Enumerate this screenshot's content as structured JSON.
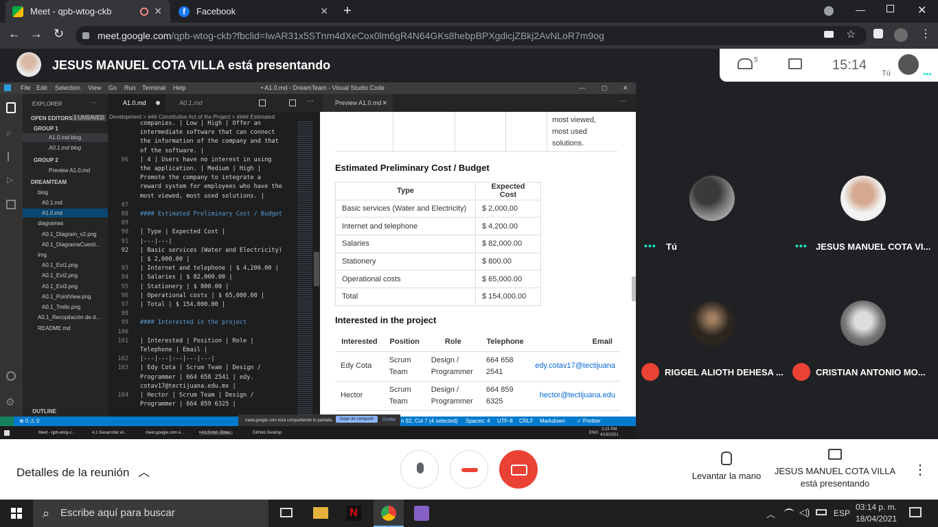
{
  "browser": {
    "tabs": [
      {
        "label": "Meet - qpb-wtog-ckb",
        "active": true
      },
      {
        "label": "Facebook",
        "active": false
      }
    ],
    "url_host": "meet.google.com",
    "url_path": "/qpb-wtog-ckb?fbclid=IwAR31x5STnm4dXeCox0lm6gR4N64GKs8hebpBPXgdicjZBkj2AvNLoR7m9og"
  },
  "meet": {
    "presenter_banner": "JESUS MANUEL COTA VILLA está presentando",
    "people_count": "5",
    "time": "15:14",
    "me_label": "Tú",
    "participants": [
      {
        "name": "Tú",
        "muted": false
      },
      {
        "name": "JESUS MANUEL COTA VI...",
        "muted": false
      },
      {
        "name": "RIGGEL ALIOTH DEHESA ...",
        "muted": true
      },
      {
        "name": "CRISTIAN ANTONIO MO...",
        "muted": true
      }
    ],
    "meeting_details": "Detalles de la reunión",
    "raise_hand": "Levantar la mano",
    "presenting_1": "JESUS MANUEL COTA VILLA",
    "presenting_2": "está presentando"
  },
  "vscode": {
    "menu": [
      "File",
      "Edit",
      "Selection",
      "View",
      "Go",
      "Run",
      "Terminal",
      "Help"
    ],
    "title": "• A1.0.md - DreamTeam - Visual Studio Code",
    "explorer": {
      "header": "EXPLORER",
      "open_editors": "OPEN EDITORS",
      "unsaved": "1 UNSAVED",
      "group1": "GROUP 1",
      "group2": "GROUP 2",
      "g1_files": [
        "A1.0.md blog",
        "A0.1.md blog"
      ],
      "g2_files": [
        "Preview A1.0.md"
      ],
      "workspace": "DREAMTEAM",
      "tree": [
        "blog",
        "A0.1.md",
        "A1.0.md",
        "diagramas",
        "A0.1_Diagram_v2.png",
        "A0.1_DiagramaCuesti...",
        "img",
        "A0.1_Evi1.png",
        "A0.1_Evi2.png",
        "A0.1_Evi3.png",
        "A0.1_PointView.png",
        "A0.1_Trello.png",
        "A0.1_Recopilación de d...",
        "README.md"
      ],
      "outline": "OUTLINE"
    },
    "editor_tabs": [
      "A1.0.md",
      "A0.1.md"
    ],
    "breadcrumb": "Development > ### Constitutive Act of the Project > #### Estimated",
    "code": [
      [
        "",
        "companies. | Low | High | Offer an"
      ],
      [
        "",
        "intermediate software that can connect"
      ],
      [
        "",
        "the information of the company and that"
      ],
      [
        "",
        "of the software. |"
      ],
      [
        "86",
        "| 4 | Users have no interest in using"
      ],
      [
        "",
        "the application. | Medium | High |"
      ],
      [
        "",
        "Promote the company to integrate a"
      ],
      [
        "",
        "reward system for employees who have the"
      ],
      [
        "",
        "most viewed, most used solutions. |"
      ],
      [
        "87",
        ""
      ],
      [
        "88",
        "#### Estimated Preliminary Cost / Budget"
      ],
      [
        "89",
        ""
      ],
      [
        "90",
        "| Type | Expected Cost |"
      ],
      [
        "91",
        "|---|---|"
      ],
      [
        "92",
        "| Basic services (Water and Electricity)"
      ],
      [
        "",
        "| $ 2,000.00 |"
      ],
      [
        "93",
        "| Internet and telephone | $ 4,200.00 |"
      ],
      [
        "94",
        "| Salaries | $ 82,000.00 |"
      ],
      [
        "95",
        "| Stationery | $ 800.00 |"
      ],
      [
        "96",
        "| Operational costs | $ 65,000.00 |"
      ],
      [
        "97",
        "| Total | $ 154,000.00 |"
      ],
      [
        "98",
        ""
      ],
      [
        "99",
        "#### Interested in the project"
      ],
      [
        "100",
        ""
      ],
      [
        "101",
        "| Interested  | Position  | Role  |"
      ],
      [
        "",
        "Telephone  | Email |"
      ],
      [
        "102",
        "|---|---|---|---|---|"
      ],
      [
        "103",
        "| Edy Cota | Scrum Team | Design /"
      ],
      [
        "",
        "Programmer | 664 658 2541 | edy."
      ],
      [
        "",
        "cotav17@tectijuana.edu.mx |"
      ],
      [
        "104",
        "| Hector | Scrum Team | Design /"
      ],
      [
        "",
        "Programmer | 664 859 6325 |"
      ]
    ],
    "preview_tab": "Preview A1.0.md",
    "preview_top": [
      "most viewed,",
      "most used",
      "solutions."
    ],
    "cost_title": "Estimated Preliminary Cost / Budget",
    "cost_headers": [
      "Type",
      "Expected Cost"
    ],
    "cost_rows": [
      [
        "Basic services (Water and Electricity)",
        "$ 2,000.00"
      ],
      [
        "Internet and telephone",
        "$ 4,200.00"
      ],
      [
        "Salaries",
        "$ 82,000.00"
      ],
      [
        "Stationery",
        "$ 800.00"
      ],
      [
        "Operational costs",
        "$ 65,000.00"
      ],
      [
        "Total",
        "$ 154,000.00"
      ]
    ],
    "interest_title": "Interested in the project",
    "interest_headers": [
      "Interested",
      "Position",
      "Role",
      "Telephone",
      "Email"
    ],
    "interest_rows": [
      [
        "Edy Cota",
        "Scrum Team",
        "Design / Programmer",
        "664 658 2541",
        "edy.cotav17@tectijuana"
      ],
      [
        "Hector",
        "Scrum Team",
        "Design / Programmer",
        "664 859 6325",
        "hector@tectijuana.edu"
      ]
    ],
    "status": {
      "left": "⊗ 0 ⚠ 0",
      "sharing": "meet.google.com está compartiendo tu pantalla.",
      "stop_share": "Dejar de compartir",
      "hide": "Ocultar",
      "pos": "n 92, Col 7 (4 selected)",
      "spaces": "Spaces: 4",
      "enc": "UTF-8",
      "eol": "CRLF",
      "lang": "Markdown",
      "prettier": "✓ Prettier"
    },
    "inner_taskbar": [
      "Meet - qpb-wtog-c...",
      "4.1 Desarrollar el...",
      "meet.google.com e...",
      "• A1.0.md - Drea...",
      "GitHub Desktop"
    ],
    "inner_clock": "3:15 PM",
    "inner_date": "4/18/2021",
    "inner_lang": "ENG"
  },
  "windows": {
    "search_placeholder": "Escribe aquí para buscar",
    "lang": "ESP",
    "time": "03:14 p. m.",
    "date": "18/04/2021"
  },
  "colors": {
    "meet_red": "#ea4335",
    "vscode_blue": "#007acc",
    "meet_green": "#1ce4c8"
  }
}
